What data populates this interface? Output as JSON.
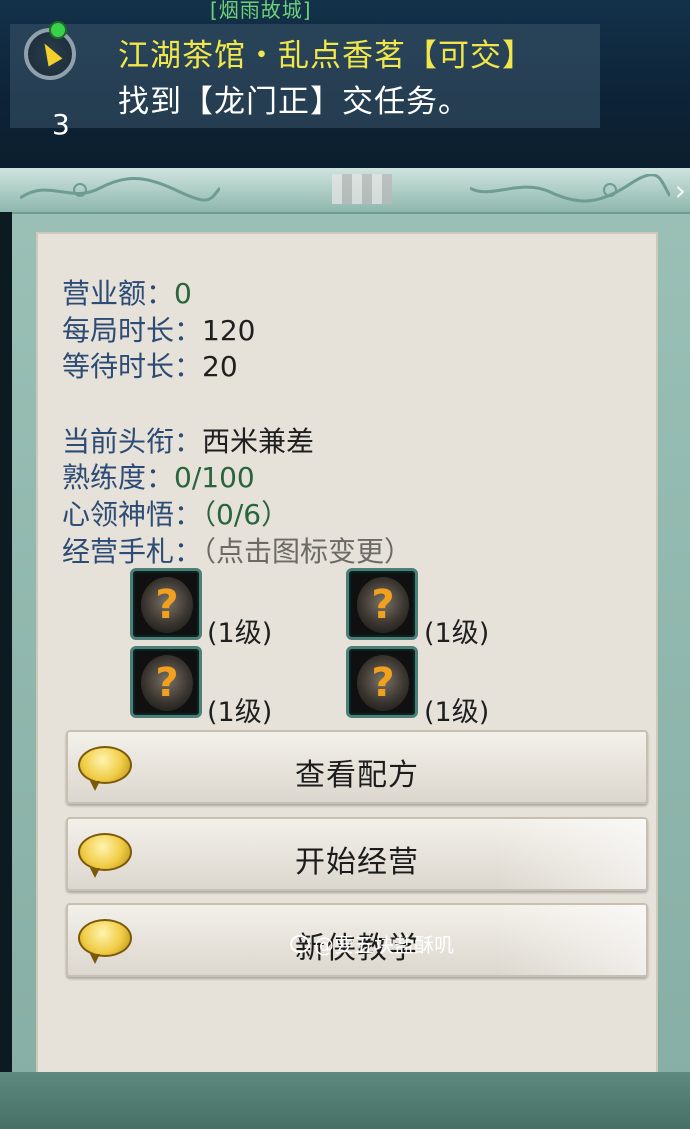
{
  "location": {
    "area_name": "[烟雨故城]"
  },
  "quest": {
    "count": "3",
    "title": "江湖茶馆・乱点香茗【可交】",
    "description": "找到【龙门正】交任务。"
  },
  "stats": {
    "revenue_label": "营业额：",
    "revenue_value": "0",
    "round_time_label": "每局时长：",
    "round_time_value": "120",
    "wait_time_label": "等待时长：",
    "wait_time_value": "20",
    "title_label": "当前头衔：",
    "title_value": "西米兼差",
    "proficiency_label": "熟练度：",
    "proficiency_value": "0/100",
    "insight_label": "心领神悟：",
    "insight_value": "（0/6）",
    "notes_label": "经营手札：",
    "notes_hint": "（点击图标变更）"
  },
  "tools": [
    {
      "icon": "question-mark-icon",
      "symbol": "?",
      "level": "(1级)"
    },
    {
      "icon": "question-mark-icon",
      "symbol": "?",
      "level": "(1级)"
    },
    {
      "icon": "question-mark-icon",
      "symbol": "?",
      "level": "(1级)"
    },
    {
      "icon": "question-mark-icon",
      "symbol": "?",
      "level": "(1级)"
    }
  ],
  "buttons": {
    "recipes": "查看配方",
    "start": "开始经营",
    "tutorial": "新侠教学"
  },
  "watermark": {
    "text": "@要五块盐酥叽"
  },
  "colors": {
    "label_blue": "#2d4c75",
    "value_green": "#28643c",
    "quest_yellow": "#f1e64a",
    "panel_teal": "#9bc1b7",
    "panel_inner": "#e6e1d9"
  }
}
